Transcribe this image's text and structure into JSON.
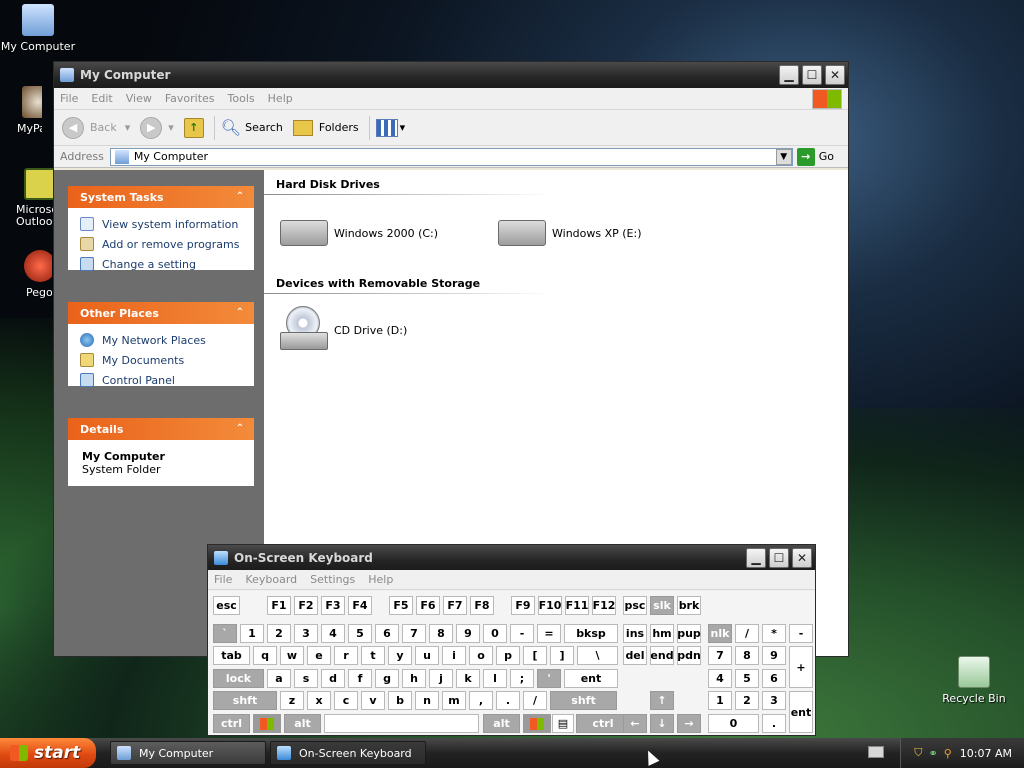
{
  "desktop_icons": [
    {
      "label": "My Computer"
    },
    {
      "label": "MyPal"
    },
    {
      "label": "Microsc Outloo"
    },
    {
      "label": "Pego"
    },
    {
      "label": "Recycle Bin"
    }
  ],
  "explorer": {
    "title": "My Computer",
    "menu": [
      "File",
      "Edit",
      "View",
      "Favorites",
      "Tools",
      "Help"
    ],
    "toolbar": {
      "back": "Back",
      "search": "Search",
      "folders": "Folders"
    },
    "address_label": "Address",
    "address_value": "My Computer",
    "go_label": "Go",
    "panels": {
      "system_tasks": {
        "title": "System Tasks",
        "items": [
          "View system information",
          "Add or remove programs",
          "Change a setting"
        ]
      },
      "other_places": {
        "title": "Other Places",
        "items": [
          "My Network Places",
          "My Documents",
          "Control Panel"
        ]
      },
      "details": {
        "title": "Details",
        "name": "My Computer",
        "type": "System Folder"
      }
    },
    "sections": {
      "hard_disks": {
        "title": "Hard Disk Drives",
        "drives": [
          "Windows 2000 (C:)",
          "Windows XP (E:)"
        ]
      },
      "removable": {
        "title": "Devices with Removable Storage",
        "drives": [
          "CD Drive (D:)"
        ]
      }
    }
  },
  "osk": {
    "title": "On-Screen Keyboard",
    "menu": [
      "File",
      "Keyboard",
      "Settings",
      "Help"
    ],
    "keys": {
      "r1": [
        "esc",
        "F1",
        "F2",
        "F3",
        "F4",
        "F5",
        "F6",
        "F7",
        "F8",
        "F9",
        "F10",
        "F11",
        "F12",
        "psc",
        "slk",
        "brk"
      ],
      "r2": [
        "`",
        "1",
        "2",
        "3",
        "4",
        "5",
        "6",
        "7",
        "8",
        "9",
        "0",
        "-",
        "=",
        "bksp",
        "ins",
        "hm",
        "pup",
        "nlk",
        "/",
        "*",
        "-"
      ],
      "r3": [
        "tab",
        "q",
        "w",
        "e",
        "r",
        "t",
        "y",
        "u",
        "i",
        "o",
        "p",
        "[",
        "]",
        "\\",
        "del",
        "end",
        "pdn",
        "7",
        "8",
        "9",
        "+"
      ],
      "r4": [
        "lock",
        "a",
        "s",
        "d",
        "f",
        "g",
        "h",
        "j",
        "k",
        "l",
        ";",
        "'",
        "ent",
        "4",
        "5",
        "6"
      ],
      "r5": [
        "shft",
        "z",
        "x",
        "c",
        "v",
        "b",
        "n",
        "m",
        ",",
        ".",
        "/",
        "shft",
        "1",
        "2",
        "3",
        "ent"
      ],
      "r6": [
        "ctrl",
        "alt",
        "alt",
        "ctrl",
        "0",
        "."
      ]
    }
  },
  "taskbar": {
    "start": "start",
    "tasks": [
      "My Computer",
      "On-Screen Keyboard"
    ],
    "clock": "10:07 AM"
  },
  "colors": {
    "panel_header": "#e9621a",
    "link": "#1c3d6e",
    "link_blue": "#0b5db8"
  }
}
